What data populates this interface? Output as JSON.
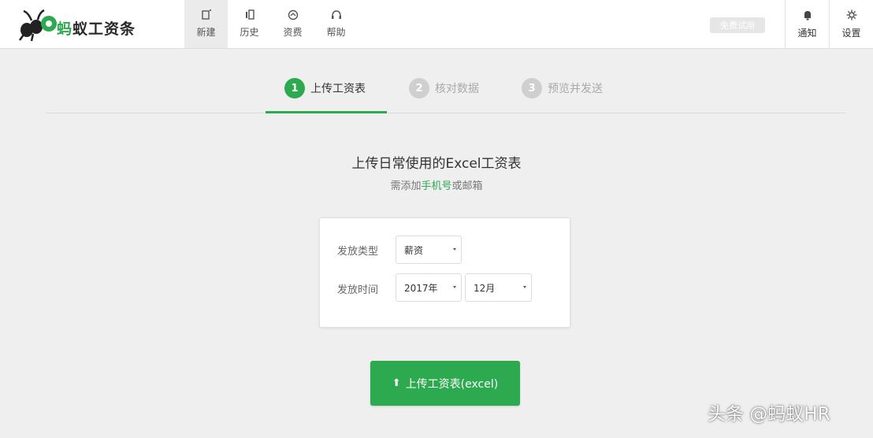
{
  "app": {
    "logo_text_green": "蚂",
    "logo_text_rest": "蚁工资条",
    "brand_color": "#2da94f"
  },
  "nav": [
    {
      "label": "新建",
      "icon": "new-file-icon",
      "active": true
    },
    {
      "label": "历史",
      "icon": "history-icon",
      "active": false
    },
    {
      "label": "资费",
      "icon": "pricing-icon",
      "active": false
    },
    {
      "label": "帮助",
      "icon": "headset-icon",
      "active": false
    }
  ],
  "header": {
    "trial_label": "免费试用",
    "notify_label": "通知",
    "settings_label": "设置"
  },
  "steps": [
    {
      "num": "1",
      "label": "上传工资表",
      "state": "active"
    },
    {
      "num": "2",
      "label": "核对数据",
      "state": "inactive"
    },
    {
      "num": "3",
      "label": "预览并发送",
      "state": "inactive"
    }
  ],
  "main": {
    "title": "上传日常使用的Excel工资表",
    "subtitle_pre": "需添加",
    "subtitle_highlight": "手机号",
    "subtitle_post": "或邮箱"
  },
  "form": {
    "type_label": "发放类型",
    "type_value": "薪资",
    "time_label": "发放时间",
    "year_value": "2017年",
    "month_value": "12月"
  },
  "upload": {
    "icon": "upload-arrow-icon",
    "label": "上传工资表(excel)"
  },
  "watermark": "头条 @蚂蚁HR"
}
